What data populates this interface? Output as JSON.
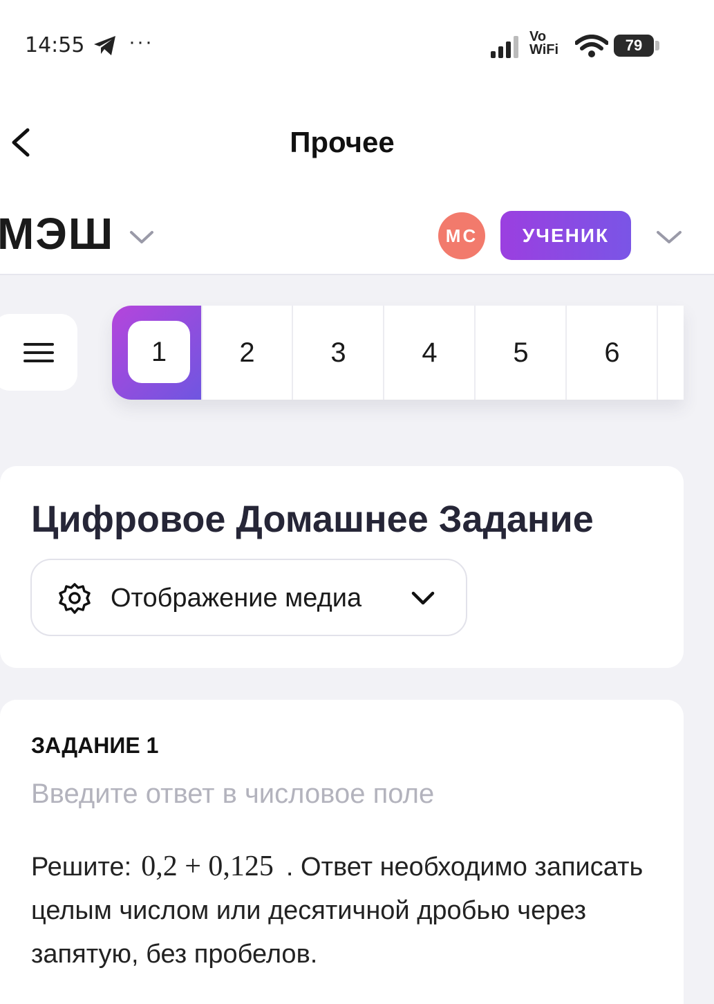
{
  "status_bar": {
    "time": "14:55",
    "more": "···",
    "network": "Vo\nWiFi",
    "battery": "79",
    "icons": [
      "telegram-icon",
      "signal-icon",
      "wifi-icon",
      "battery-icon"
    ]
  },
  "nav": {
    "back_icon": "chevron-left-icon",
    "title": "Прочее"
  },
  "header": {
    "logo": "МЭШ",
    "avatar_initials": "МС",
    "role": "УЧЕНИК",
    "colors": {
      "avatar": "#f27a6c",
      "role_gradient_start": "#9b3fe0",
      "role_gradient_end": "#7a55e6"
    }
  },
  "pager": {
    "menu_icon": "hamburger-icon",
    "pages": [
      "1",
      "2",
      "3",
      "4",
      "5",
      "6"
    ],
    "active": "1"
  },
  "homework": {
    "title": "Цифровое Домашнее Задание",
    "media_label": "Отображение медиа",
    "media_icons": [
      "gear-icon",
      "chevron-down-icon"
    ]
  },
  "task": {
    "heading": "ЗАДАНИЕ 1",
    "hint": "Введите ответ в числовое поле",
    "prefix": "Решите:",
    "expression": "0,2 + 0,125",
    "suffix": ". Ответ необходимо записать целым числом или десятичной дробью через запятую, без пробелов."
  }
}
